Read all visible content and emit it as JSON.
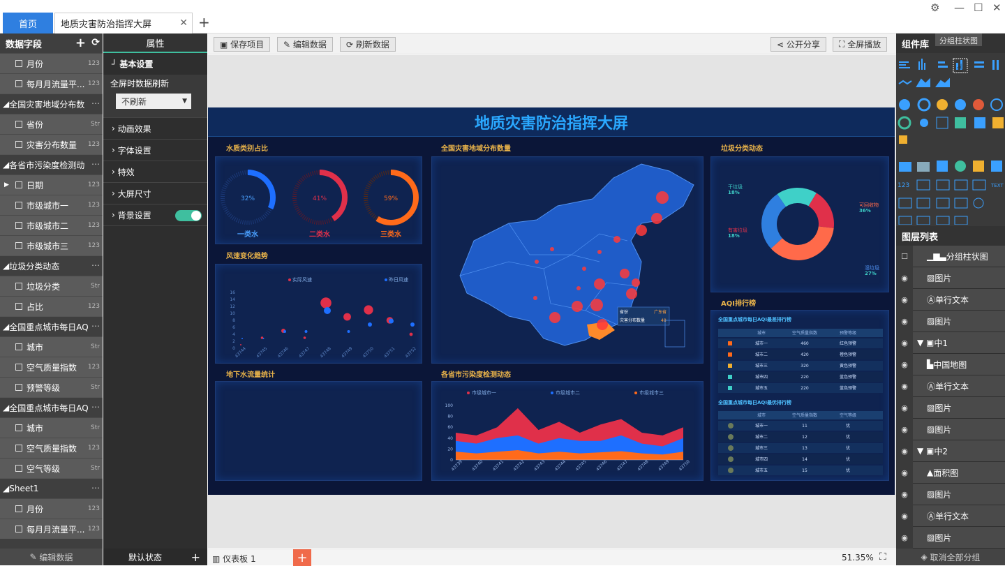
{
  "tabs": {
    "home": "首页",
    "doc": "地质灾害防治指挥大屏"
  },
  "left": {
    "title": "数据字段",
    "groups": [
      {
        "label": "全国灾害地域分布数"
      },
      {
        "label": "各省市污染度检测动"
      },
      {
        "label": "垃圾分类动态"
      },
      {
        "label": "全国重点城市每日AQ"
      },
      {
        "label": "全国重点城市每日AQ"
      },
      {
        "label": "Sheet1"
      }
    ],
    "fields": {
      "f1": "月份",
      "f2": "每月月流量平...",
      "f3": "省份",
      "f4": "灾害分布数量",
      "f5": "日期",
      "f6": "市级城市一",
      "f7": "市级城市二",
      "f8": "市级城市三",
      "f9": "垃圾分类",
      "f10": "占比",
      "f11": "城市",
      "f12": "空气质量指数",
      "f13": "预警等级",
      "f14": "城市",
      "f15": "空气质量指数",
      "f16": "空气等级",
      "f17": "月份",
      "f18": "每月月流量平..."
    },
    "types": {
      "num": "123",
      "str": "Str"
    },
    "footer": "编辑数据"
  },
  "prop": {
    "tab": "属性",
    "basic": "基本设置",
    "refresh_label": "全屏时数据刷新",
    "refresh_value": "不刷新",
    "anim": "动画效果",
    "font": "字体设置",
    "effect": "特效",
    "size": "大屏尺寸",
    "bg": "背景设置",
    "footer": "默认状态"
  },
  "toolbar": {
    "save": "保存项目",
    "edit": "编辑数据",
    "refresh": "刷新数据",
    "share": "公开分享",
    "fullscreen": "全屏播放"
  },
  "screen": {
    "title": "地质灾害防治指挥大屏",
    "water": {
      "title": "水质类别占比",
      "items": [
        {
          "pct": "32%",
          "label": "一类水",
          "frac": 0.32
        },
        {
          "pct": "41%",
          "label": "二类水",
          "frac": 0.41
        },
        {
          "pct": "59%",
          "label": "三类水",
          "frac": 0.59
        }
      ]
    },
    "wind": {
      "title": "风速变化趋势",
      "legend1": "实际风速",
      "legend2": "昨日风速"
    },
    "map": {
      "title": "全国灾害地域分布数量",
      "tip_k1": "省份",
      "tip_v1": "广东省",
      "tip_k2": "灾害分布数量",
      "tip_v2": "48"
    },
    "garbage": {
      "title": "垃圾分类动态",
      "l1": "干垃圾",
      "p1": "18%",
      "l2": "有害垃圾",
      "p2": "18%",
      "l3": "可回收物",
      "p3": "36%",
      "l4": "湿垃圾",
      "p4": "27%"
    },
    "aqi": {
      "title": "AQI排行榜",
      "t1": "全国重点城市每日AQI最差排行榜",
      "h1": [
        "城市",
        "空气质量指数",
        "预警等级"
      ],
      "r1": [
        [
          "城市一",
          "460",
          "红色预警"
        ],
        [
          "城市二",
          "420",
          "橙色预警"
        ],
        [
          "城市三",
          "320",
          "黄色预警"
        ],
        [
          "城市四",
          "220",
          "蓝色预警"
        ],
        [
          "城市五",
          "220",
          "蓝色预警"
        ]
      ],
      "t2": "全国重点城市每日AQI最优排行榜",
      "h2": [
        "城市",
        "空气质量指数",
        "空气等级"
      ],
      "r2": [
        [
          "城市一",
          "11",
          "优"
        ],
        [
          "城市二",
          "12",
          "优"
        ],
        [
          "城市三",
          "13",
          "优"
        ],
        [
          "城市四",
          "14",
          "优"
        ],
        [
          "城市五",
          "15",
          "优"
        ]
      ]
    },
    "ground": {
      "title": "地下水流量统计"
    },
    "pollution": {
      "title": "各省市污染度检测动态",
      "legend": [
        "市级城市一",
        "市级城市二",
        "市级城市三"
      ]
    }
  },
  "right": {
    "title": "组件库",
    "tooltip": "分组柱状图",
    "layers_title": "图层列表",
    "layers": [
      "分组柱状图",
      "图片",
      "单行文本",
      "图片",
      "中1",
      "中国地图",
      "单行文本",
      "图片",
      "图片",
      "中2",
      "面积图",
      "图片",
      "单行文本",
      "图片"
    ],
    "footer": "取消全部分组"
  },
  "bottom": {
    "sheet": "仪表板 1",
    "zoom": "51.35%"
  },
  "colors": {
    "accent": "#2f7fe0",
    "teal": "#3fbf9f",
    "screen_bg": "#0b1638"
  },
  "chart_data": [
    {
      "type": "pie",
      "title": "垃圾分类动态",
      "categories": [
        "干垃圾",
        "有害垃圾",
        "可回收物",
        "湿垃圾"
      ],
      "values": [
        18,
        18,
        36,
        27
      ]
    },
    {
      "type": "scatter",
      "title": "风速变化趋势",
      "x": [
        "43744",
        "43745",
        "43746",
        "43747",
        "43748",
        "43749",
        "43750",
        "43751",
        "43752"
      ],
      "ylim": [
        0,
        16
      ],
      "series": [
        {
          "name": "实际风速",
          "values": [
            1,
            3,
            5,
            3,
            13,
            9,
            11,
            8,
            4
          ]
        },
        {
          "name": "昨日风速",
          "values": [
            2,
            2,
            4,
            4,
            10,
            4,
            6,
            7,
            6
          ]
        }
      ]
    },
    {
      "type": "area",
      "title": "各省市污染度检测动态",
      "x": [
        "43739",
        "43740",
        "43741",
        "43742",
        "43743",
        "43744",
        "43745",
        "43746",
        "43747",
        "43748",
        "43749",
        "43750"
      ],
      "ylim": [
        0,
        100
      ],
      "series": [
        {
          "name": "市级城市一",
          "values": [
            50,
            45,
            60,
            95,
            55,
            70,
            50,
            65,
            75,
            50,
            45,
            60
          ]
        },
        {
          "name": "市级城市二",
          "values": [
            35,
            30,
            40,
            45,
            30,
            40,
            35,
            35,
            45,
            30,
            25,
            40
          ]
        },
        {
          "name": "市级城市三",
          "values": [
            15,
            12,
            15,
            18,
            12,
            15,
            12,
            14,
            16,
            12,
            10,
            15
          ]
        }
      ]
    }
  ]
}
